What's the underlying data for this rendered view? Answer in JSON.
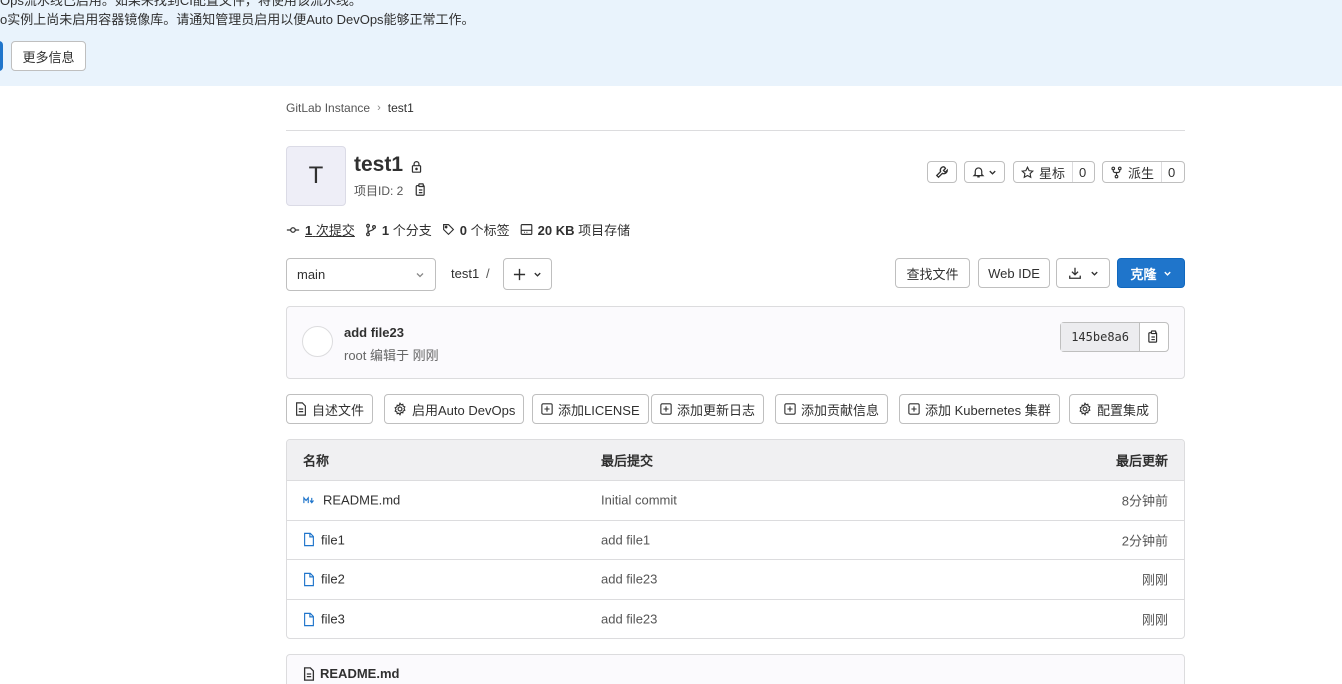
{
  "banner": {
    "line1": "Ops流水线已启用。如果未找到CI配置文件，将使用该流水线。",
    "line2": "o实例上尚未启用容器镜像库。请通知管理员启用以便Auto DevOps能够正常工作。",
    "more_label": "更多信息"
  },
  "breadcrumb": {
    "instance": "GitLab Instance",
    "project": "test1"
  },
  "project": {
    "avatar_letter": "T",
    "name": "test1",
    "id_label": "项目ID: 2",
    "star_label": "星标",
    "star_count": "0",
    "fork_label": "派生",
    "fork_count": "0"
  },
  "stats": {
    "commits_num": "1",
    "commits_label": "次提交",
    "branches_num": "1",
    "branches_label": "个分支",
    "tags_num": "0",
    "tags_label": "个标签",
    "storage_num": "20 KB",
    "storage_label": "项目存储"
  },
  "repo_nav": {
    "branch": "main",
    "path": "test1",
    "path_sep": "/",
    "find_file": "查找文件",
    "web_ide": "Web IDE",
    "clone": "克隆"
  },
  "commit": {
    "title": "add file23",
    "meta": "root 编辑于 刚刚",
    "sha": "145be8a6"
  },
  "quick_actions": [
    "自述文件",
    "启用Auto DevOps",
    "添加LICENSE",
    "添加更新日志",
    "添加贡献信息",
    "添加 Kubernetes 集群",
    "配置集成"
  ],
  "file_table": {
    "headers": {
      "name": "名称",
      "last_commit": "最后提交",
      "last_update": "最后更新"
    },
    "rows": [
      {
        "name": "README.md",
        "icon": "markdown-icon",
        "commit": "Initial commit",
        "updated": "8分钟前"
      },
      {
        "name": "file1",
        "icon": "file-icon",
        "commit": "add file1",
        "updated": "2分钟前"
      },
      {
        "name": "file2",
        "icon": "file-icon",
        "commit": "add file23",
        "updated": "刚刚"
      },
      {
        "name": "file3",
        "icon": "file-icon",
        "commit": "add file23",
        "updated": "刚刚"
      }
    ]
  },
  "readme": {
    "title": "README.md"
  },
  "colors": {
    "accent": "#1f75cb",
    "banner_bg": "#e9f3fc",
    "link_icon": "#1f75cb"
  }
}
